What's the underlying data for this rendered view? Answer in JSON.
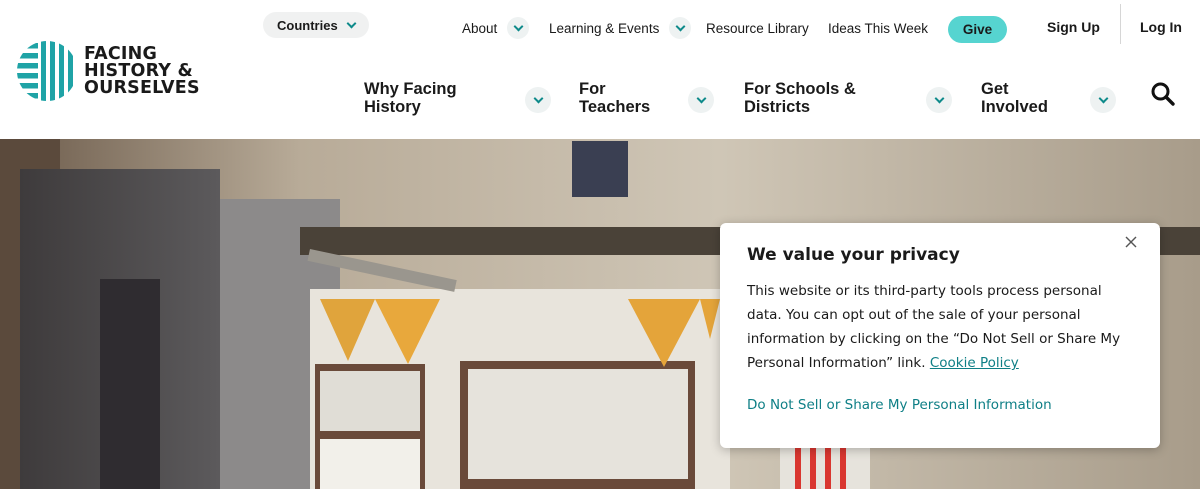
{
  "logo": {
    "lines": [
      "FACING",
      "HISTORY &",
      "OURSELVES"
    ],
    "colors": {
      "teal": "#1fa3a6",
      "navy": "#1b2a4a"
    }
  },
  "countries": {
    "label": "Countries"
  },
  "util_nav": {
    "items": [
      {
        "label": "About",
        "has_dropdown": true
      },
      {
        "label": "Learning & Events",
        "has_dropdown": true
      },
      {
        "label": "Resource Library",
        "has_dropdown": false
      },
      {
        "label": "Ideas This Week",
        "has_dropdown": false
      }
    ],
    "give_label": "Give",
    "signup_label": "Sign Up",
    "login_label": "Log In"
  },
  "main_nav": {
    "items": [
      {
        "line1": "Why Facing",
        "line2": "History"
      },
      {
        "line1": "For",
        "line2": "Teachers"
      },
      {
        "line1": "For Schools &",
        "line2": "Districts"
      },
      {
        "line1": "Get",
        "line2": "Involved"
      }
    ]
  },
  "icons": {
    "search": "search-icon",
    "close": "close-icon",
    "chevron": "chevron-down-icon"
  },
  "privacy": {
    "title": "We value your privacy",
    "body": "This website or its third-party tools process personal data. You can opt out of the sale of your personal information by clicking on the “Do Not Sell or Share My Personal Information” link.",
    "cookie_link": "Cookie Policy",
    "dns_link": "Do Not Sell or Share My Personal Information"
  },
  "colors": {
    "accent": "#56d4d0",
    "link": "#0e7f86",
    "chevron": "#0e8a8a"
  }
}
